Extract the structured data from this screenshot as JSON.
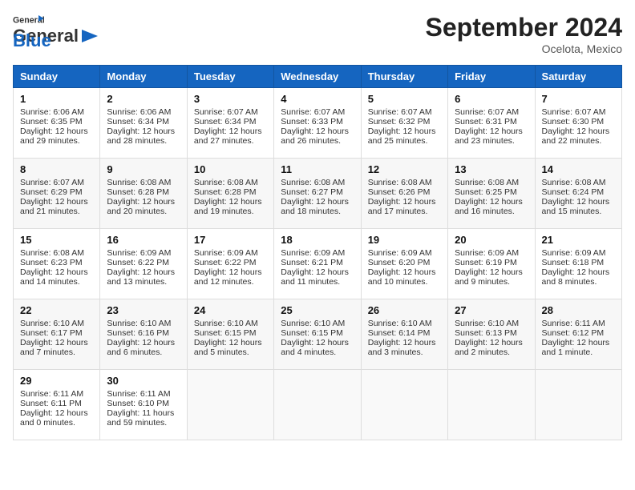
{
  "header": {
    "logo_general": "General",
    "logo_blue": "Blue",
    "title": "September 2024",
    "location": "Ocelota, Mexico"
  },
  "weekdays": [
    "Sunday",
    "Monday",
    "Tuesday",
    "Wednesday",
    "Thursday",
    "Friday",
    "Saturday"
  ],
  "weeks": [
    [
      {
        "day": "1",
        "sunrise": "Sunrise: 6:06 AM",
        "sunset": "Sunset: 6:35 PM",
        "daylight": "Daylight: 12 hours and 29 minutes."
      },
      {
        "day": "2",
        "sunrise": "Sunrise: 6:06 AM",
        "sunset": "Sunset: 6:34 PM",
        "daylight": "Daylight: 12 hours and 28 minutes."
      },
      {
        "day": "3",
        "sunrise": "Sunrise: 6:07 AM",
        "sunset": "Sunset: 6:34 PM",
        "daylight": "Daylight: 12 hours and 27 minutes."
      },
      {
        "day": "4",
        "sunrise": "Sunrise: 6:07 AM",
        "sunset": "Sunset: 6:33 PM",
        "daylight": "Daylight: 12 hours and 26 minutes."
      },
      {
        "day": "5",
        "sunrise": "Sunrise: 6:07 AM",
        "sunset": "Sunset: 6:32 PM",
        "daylight": "Daylight: 12 hours and 25 minutes."
      },
      {
        "day": "6",
        "sunrise": "Sunrise: 6:07 AM",
        "sunset": "Sunset: 6:31 PM",
        "daylight": "Daylight: 12 hours and 23 minutes."
      },
      {
        "day": "7",
        "sunrise": "Sunrise: 6:07 AM",
        "sunset": "Sunset: 6:30 PM",
        "daylight": "Daylight: 12 hours and 22 minutes."
      }
    ],
    [
      {
        "day": "8",
        "sunrise": "Sunrise: 6:07 AM",
        "sunset": "Sunset: 6:29 PM",
        "daylight": "Daylight: 12 hours and 21 minutes."
      },
      {
        "day": "9",
        "sunrise": "Sunrise: 6:08 AM",
        "sunset": "Sunset: 6:28 PM",
        "daylight": "Daylight: 12 hours and 20 minutes."
      },
      {
        "day": "10",
        "sunrise": "Sunrise: 6:08 AM",
        "sunset": "Sunset: 6:28 PM",
        "daylight": "Daylight: 12 hours and 19 minutes."
      },
      {
        "day": "11",
        "sunrise": "Sunrise: 6:08 AM",
        "sunset": "Sunset: 6:27 PM",
        "daylight": "Daylight: 12 hours and 18 minutes."
      },
      {
        "day": "12",
        "sunrise": "Sunrise: 6:08 AM",
        "sunset": "Sunset: 6:26 PM",
        "daylight": "Daylight: 12 hours and 17 minutes."
      },
      {
        "day": "13",
        "sunrise": "Sunrise: 6:08 AM",
        "sunset": "Sunset: 6:25 PM",
        "daylight": "Daylight: 12 hours and 16 minutes."
      },
      {
        "day": "14",
        "sunrise": "Sunrise: 6:08 AM",
        "sunset": "Sunset: 6:24 PM",
        "daylight": "Daylight: 12 hours and 15 minutes."
      }
    ],
    [
      {
        "day": "15",
        "sunrise": "Sunrise: 6:08 AM",
        "sunset": "Sunset: 6:23 PM",
        "daylight": "Daylight: 12 hours and 14 minutes."
      },
      {
        "day": "16",
        "sunrise": "Sunrise: 6:09 AM",
        "sunset": "Sunset: 6:22 PM",
        "daylight": "Daylight: 12 hours and 13 minutes."
      },
      {
        "day": "17",
        "sunrise": "Sunrise: 6:09 AM",
        "sunset": "Sunset: 6:22 PM",
        "daylight": "Daylight: 12 hours and 12 minutes."
      },
      {
        "day": "18",
        "sunrise": "Sunrise: 6:09 AM",
        "sunset": "Sunset: 6:21 PM",
        "daylight": "Daylight: 12 hours and 11 minutes."
      },
      {
        "day": "19",
        "sunrise": "Sunrise: 6:09 AM",
        "sunset": "Sunset: 6:20 PM",
        "daylight": "Daylight: 12 hours and 10 minutes."
      },
      {
        "day": "20",
        "sunrise": "Sunrise: 6:09 AM",
        "sunset": "Sunset: 6:19 PM",
        "daylight": "Daylight: 12 hours and 9 minutes."
      },
      {
        "day": "21",
        "sunrise": "Sunrise: 6:09 AM",
        "sunset": "Sunset: 6:18 PM",
        "daylight": "Daylight: 12 hours and 8 minutes."
      }
    ],
    [
      {
        "day": "22",
        "sunrise": "Sunrise: 6:10 AM",
        "sunset": "Sunset: 6:17 PM",
        "daylight": "Daylight: 12 hours and 7 minutes."
      },
      {
        "day": "23",
        "sunrise": "Sunrise: 6:10 AM",
        "sunset": "Sunset: 6:16 PM",
        "daylight": "Daylight: 12 hours and 6 minutes."
      },
      {
        "day": "24",
        "sunrise": "Sunrise: 6:10 AM",
        "sunset": "Sunset: 6:15 PM",
        "daylight": "Daylight: 12 hours and 5 minutes."
      },
      {
        "day": "25",
        "sunrise": "Sunrise: 6:10 AM",
        "sunset": "Sunset: 6:15 PM",
        "daylight": "Daylight: 12 hours and 4 minutes."
      },
      {
        "day": "26",
        "sunrise": "Sunrise: 6:10 AM",
        "sunset": "Sunset: 6:14 PM",
        "daylight": "Daylight: 12 hours and 3 minutes."
      },
      {
        "day": "27",
        "sunrise": "Sunrise: 6:10 AM",
        "sunset": "Sunset: 6:13 PM",
        "daylight": "Daylight: 12 hours and 2 minutes."
      },
      {
        "day": "28",
        "sunrise": "Sunrise: 6:11 AM",
        "sunset": "Sunset: 6:12 PM",
        "daylight": "Daylight: 12 hours and 1 minute."
      }
    ],
    [
      {
        "day": "29",
        "sunrise": "Sunrise: 6:11 AM",
        "sunset": "Sunset: 6:11 PM",
        "daylight": "Daylight: 12 hours and 0 minutes."
      },
      {
        "day": "30",
        "sunrise": "Sunrise: 6:11 AM",
        "sunset": "Sunset: 6:10 PM",
        "daylight": "Daylight: 11 hours and 59 minutes."
      },
      null,
      null,
      null,
      null,
      null
    ]
  ]
}
